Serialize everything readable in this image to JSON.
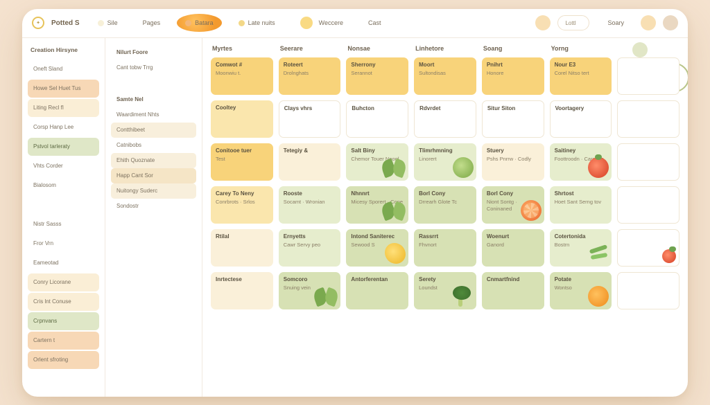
{
  "header": {
    "appName": "Potted S",
    "tabs": [
      {
        "label": "Sile"
      },
      {
        "label": "Pages"
      },
      {
        "label": "Batara"
      },
      {
        "label": "Late nuits"
      },
      {
        "label": "Weccere"
      },
      {
        "label": "Cast"
      }
    ],
    "chipText": "Lottl",
    "storyLabel": "Soary"
  },
  "sidebar1": {
    "heading": "Creation Hirsyne",
    "items": [
      {
        "label": "Oneft Sland",
        "variant": ""
      },
      {
        "label": "Howe Sel Huet Tus",
        "variant": "peach"
      },
      {
        "label": "Liting Recl fI",
        "variant": "cream"
      },
      {
        "label": "Corsp Hanp Lee",
        "variant": ""
      },
      {
        "label": "Pstvol tarleraty",
        "variant": "green"
      },
      {
        "label": "Vhts Corder",
        "variant": ""
      },
      {
        "label": "Bialosom",
        "variant": ""
      },
      {
        "label": "",
        "variant": ""
      },
      {
        "label": "Nistr Sasss",
        "variant": ""
      },
      {
        "label": "Fror Vrn",
        "variant": ""
      },
      {
        "label": "Eameotad",
        "variant": ""
      },
      {
        "label": "Conry Licorane",
        "variant": "cream"
      },
      {
        "label": "Cris lnt Conuse",
        "variant": "cream"
      },
      {
        "label": "Crpnvans",
        "variant": "green"
      },
      {
        "label": "Cartern t",
        "variant": "peach"
      },
      {
        "label": "Orlent sfroting",
        "variant": "peach"
      }
    ]
  },
  "sidebar2": {
    "items": [
      {
        "label": "Nilurt Foore",
        "variant": "head"
      },
      {
        "label": "Cant tobw Trrg",
        "variant": ""
      },
      {
        "label": "",
        "variant": "spacer"
      },
      {
        "label": "",
        "variant": "spacer"
      },
      {
        "label": "",
        "variant": "spacer"
      },
      {
        "label": "",
        "variant": "spacer"
      },
      {
        "label": "Samte Nel",
        "variant": "head"
      },
      {
        "label": "Waardiment Nhts",
        "variant": ""
      },
      {
        "label": "Contthibeet",
        "variant": "cream"
      },
      {
        "label": "Catnibobs",
        "variant": ""
      },
      {
        "label": "Ehith Quoznate",
        "variant": "cream"
      },
      {
        "label": "Happ Cant Sor",
        "variant": "tan"
      },
      {
        "label": "Nuitongy Suderc",
        "variant": "cream"
      },
      {
        "label": "Sondostr",
        "variant": ""
      }
    ]
  },
  "days": [
    {
      "name": "Myrtes"
    },
    {
      "name": "Seerare"
    },
    {
      "name": "Nonsae"
    },
    {
      "name": "Linhetore"
    },
    {
      "name": "Soang"
    },
    {
      "name": "Yorng"
    },
    {
      "name": ""
    }
  ],
  "rows": [
    [
      {
        "title": "Comwot #",
        "sub": "Moonwiu t.",
        "variant": "amb"
      },
      {
        "title": "Roteert",
        "sub": "Drolnghats",
        "variant": "amb"
      },
      {
        "title": "Sherrony",
        "sub": "Serannot",
        "variant": "amb"
      },
      {
        "title": "Moort",
        "sub": "Sultondisas",
        "variant": "amb"
      },
      {
        "title": "Pnihrt",
        "sub": "Honore",
        "variant": "amb"
      },
      {
        "title": "Nour E3",
        "sub": "Corel Nitso tert",
        "variant": "amb"
      },
      {
        "title": "",
        "sub": "",
        "variant": "white"
      }
    ],
    [
      {
        "title": "Cooltey",
        "sub": "",
        "variant": "ambL"
      },
      {
        "title": "Clays vhrs",
        "sub": "",
        "variant": "white"
      },
      {
        "title": "Buhcton",
        "sub": "",
        "variant": "white"
      },
      {
        "title": "Rdvrdet",
        "sub": "",
        "variant": "white"
      },
      {
        "title": "Situr Siton",
        "sub": "",
        "variant": "white"
      },
      {
        "title": "Voortagery",
        "sub": "",
        "variant": "white"
      },
      {
        "title": "",
        "sub": "",
        "variant": "white"
      }
    ],
    [
      {
        "title": "Conitooe tuer",
        "sub": "Test",
        "variant": "amb"
      },
      {
        "title": "Tetegiy &",
        "sub": "",
        "variant": "cream"
      },
      {
        "title": "Salt Biny",
        "sub": "Chemor Touer Noogl",
        "variant": "oliveL",
        "food": "leafy"
      },
      {
        "title": "Tlimrhmning",
        "sub": "Linorert",
        "variant": "oliveL",
        "food": "cuke"
      },
      {
        "title": "Stuery",
        "sub": "Pshs Pnrrw · Codly",
        "variant": "cream"
      },
      {
        "title": "Saitiney",
        "sub": "Foottroodn · Carense",
        "variant": "oliveL",
        "food": "tomato"
      },
      {
        "title": "",
        "sub": "",
        "variant": "white"
      }
    ],
    [
      {
        "title": "Carey To Neny",
        "sub": "Conrbrots · Srlos",
        "variant": "ambL"
      },
      {
        "title": "Rooste",
        "sub": "Socamt · Wronian",
        "variant": "oliveL"
      },
      {
        "title": "Nhnnrt",
        "sub": "Micesy Sporert · Cone",
        "variant": "olive",
        "food": "leafy"
      },
      {
        "title": "Borl Cony",
        "sub": "Drrearh Glote Tc",
        "variant": "olive"
      },
      {
        "title": "Borl Cony",
        "sub": "Niont Sontg · Coninaned",
        "variant": "olive",
        "food": "citrus"
      },
      {
        "title": "Shrtost",
        "sub": "Hoet Sant Serng tov",
        "variant": "oliveL"
      },
      {
        "title": "",
        "sub": "",
        "variant": "white"
      }
    ],
    [
      {
        "title": "Rtilal",
        "sub": "",
        "variant": "cream"
      },
      {
        "title": "Ernyetts",
        "sub": "Cawr Servy peo",
        "variant": "oliveL"
      },
      {
        "title": "Intond Saniterec",
        "sub": "Sewood S",
        "variant": "olive",
        "food": "lemon"
      },
      {
        "title": "Rassrrt",
        "sub": "Fhvnort",
        "variant": "olive"
      },
      {
        "title": "Woenurt",
        "sub": "Ganord",
        "variant": "olive"
      },
      {
        "title": "Cotertonida",
        "sub": "Bostrn",
        "variant": "oliveL",
        "food": "beans"
      },
      {
        "title": "",
        "sub": "",
        "variant": "white",
        "food": "small-tomato tomato"
      }
    ],
    [
      {
        "title": "Inrtectese",
        "sub": "",
        "variant": "cream"
      },
      {
        "title": "Somcoro",
        "sub": "Snuing vein",
        "variant": "olive",
        "food": "leafy"
      },
      {
        "title": "Antorferentan",
        "sub": "",
        "variant": "olive"
      },
      {
        "title": "Serety",
        "sub": "Loundst",
        "variant": "olive",
        "food": "broccoli"
      },
      {
        "title": "Cnmartfnind",
        "sub": "",
        "variant": "olive"
      },
      {
        "title": "Potate",
        "sub": "Wontso",
        "variant": "olive",
        "food": "orange"
      },
      {
        "title": "",
        "sub": "",
        "variant": "white"
      }
    ]
  ]
}
